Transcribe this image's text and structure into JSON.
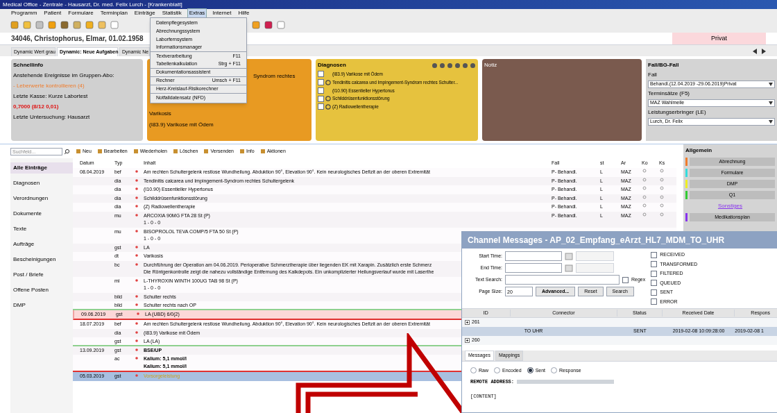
{
  "window": {
    "title": "Medical Office - Zentrale - Hausarzt, Dr. med. Felix Lurch - [Krankenblatt]"
  },
  "menu": [
    {
      "label": "Programm",
      "selected": false
    },
    {
      "label": "Patient",
      "selected": false
    },
    {
      "label": "Formulare",
      "selected": false
    },
    {
      "label": "Terminplan",
      "selected": false
    },
    {
      "label": "Einträge",
      "selected": false
    },
    {
      "label": "Statistik",
      "selected": false
    },
    {
      "label": "Extras",
      "selected": true
    },
    {
      "label": "Internet",
      "selected": false
    },
    {
      "label": "Hilfe",
      "selected": false
    }
  ],
  "dropdown": [
    {
      "label": "Datenpflegesystem",
      "separator_after": false
    },
    {
      "label": "Abrechnungssystem",
      "separator_after": false
    },
    {
      "label": "Laborfernsystem",
      "separator_after": false
    },
    {
      "label": "Informationsmanager",
      "separator_after": true
    },
    {
      "label": "Textverarbeitung",
      "shortcut": "F11",
      "separator_after": false
    },
    {
      "label": "Tabellenkalkulation",
      "shortcut": "Strg + F11",
      "separator_after": true
    },
    {
      "label": "Dokumentationsassistent",
      "separator_after": true
    },
    {
      "label": "Rechner",
      "shortcut": "Umsch + F11",
      "separator_after": true
    },
    {
      "label": "Herz-Kreislauf-Risikorechner",
      "separator_after": true
    },
    {
      "label": "Notfalldatensatz (NFD)",
      "separator_after": false
    }
  ],
  "patient": {
    "name": "34046, Christophorus, Elmar, 01.02.1958",
    "insurance": "Privat"
  },
  "tabs": [
    {
      "label": "Dynamic Wert grau",
      "selected": false
    },
    {
      "label": "Dynamic: Neue Aufgaben",
      "selected": true
    },
    {
      "label": "Dynamic Ne",
      "selected": false
    }
  ],
  "schnellinfo": {
    "title": "Schnellinfo",
    "lines": [
      {
        "kind": "normal",
        "text": "Anstehende Ereignisse im Gruppen-Abo:"
      },
      {
        "kind": "warning",
        "text": "- Leberwerte kontrollieren (4)"
      },
      {
        "kind": "normal",
        "text": "Letzte Kasse: Kurze Labortest"
      },
      {
        "kind": "alert",
        "text": "0,7000 (8/12 0,01)"
      },
      {
        "kind": "normal",
        "text": "Letzte Untersuchung: Hausarzt"
      }
    ]
  },
  "orange_panel": {
    "lines": [
      "Syndrom rechtes",
      "Varikosis",
      "(I83.9) Varikose mit Ödem"
    ]
  },
  "diagnosen": {
    "title": "Diagnosen",
    "items": [
      {
        "text": "(I83.9) Varikose mit Ödem",
        "checked": false,
        "permanent": false
      },
      {
        "text": "Tendinitis calcarea und Impingement-Syndrom rechtes Schulter...",
        "checked": false,
        "permanent": true
      },
      {
        "text": "(I10.90) Essentieller Hypertonus",
        "checked": false,
        "permanent": false
      },
      {
        "text": "Schilddrüsenfunktionsstörung",
        "checked": false,
        "permanent": true
      },
      {
        "text": "(Z) Radiowellentherapie",
        "checked": false,
        "permanent": true
      }
    ]
  },
  "notiz": {
    "title": "Notiz"
  },
  "fall_panel": {
    "title": "Fall/BG-Fall",
    "fields": [
      {
        "label": "Fall",
        "value": "Behandl.(12.04.2019 -29.06.2019)Privat"
      },
      {
        "label": "Terminsätze (F5)",
        "value": "MAZ Wahlmeile"
      },
      {
        "label": "Leistungserbringer (LE)",
        "value": "Lurch, Dr. Felix"
      }
    ]
  },
  "search": {
    "placeholder": "Suchfeld..."
  },
  "toolbar": [
    "Neu",
    "Bearbeiten",
    "Wiederholen",
    "Löschen",
    "Versenden",
    "Info",
    "Aktionen"
  ],
  "sidebar": [
    {
      "label": "Alle Einträge",
      "selected": true
    },
    {
      "label": "Diagnosen",
      "selected": false
    },
    {
      "label": "Verordnungen",
      "selected": false
    },
    {
      "label": "Dokumente",
      "selected": false
    },
    {
      "label": "Texte",
      "selected": false
    },
    {
      "label": "Aufträge",
      "selected": false
    },
    {
      "label": "Bescheinigungen",
      "selected": false
    },
    {
      "label": "Post / Briefe",
      "selected": false
    },
    {
      "label": "Offene Posten",
      "selected": false
    },
    {
      "label": "DMP",
      "selected": false
    }
  ],
  "table": {
    "columns": [
      "Datum",
      "Typ",
      "Inhalt",
      "Fall",
      "st",
      "Ar",
      "Ko",
      "Ks"
    ],
    "rows": [
      {
        "date": "08.04.2019",
        "type": "bef",
        "lines": [
          "Am rechten Schultergelenk restlose Wundheilung. Abduktion 90°, Elevation 90°. Kein neurologisches Defizit an der oberen Extremität"
        ],
        "fall": "P- Behandl.",
        "st": "L",
        "ar": "MAZ",
        "selected": false,
        "flagged": false,
        "bold": false,
        "day_end": false,
        "alert_line": false
      },
      {
        "type": "dia",
        "lines": [
          "Tendinitis calcarea und Impingement-Syndrom rechtes Schultergelenk"
        ],
        "fall": "P- Behandl.",
        "st": "L",
        "ar": "MAZ",
        "selected": false,
        "flagged": false,
        "bold": false,
        "day_end": false,
        "alert_line": false
      },
      {
        "type": "dia",
        "lines": [
          "(I10.90) Essentieller Hypertonus"
        ],
        "fall": "P- Behandl.",
        "st": "L",
        "ar": "MAZ",
        "selected": false,
        "flagged": false,
        "bold": false,
        "day_end": false,
        "alert_line": false
      },
      {
        "type": "dia",
        "lines": [
          "Schilddrüsenfunktionsstörung"
        ],
        "fall": "P- Behandl.",
        "st": "L",
        "ar": "MAZ",
        "selected": false,
        "flagged": false,
        "bold": false,
        "day_end": false,
        "alert_line": false
      },
      {
        "type": "dia",
        "lines": [
          "(Z) Radiowellentherapie"
        ],
        "fall": "P- Behandl.",
        "st": "L",
        "ar": "MAZ",
        "selected": false,
        "flagged": false,
        "bold": false,
        "day_end": false,
        "alert_line": false
      },
      {
        "type": "mu",
        "lines": [
          "ARCOXIA 90MG FTA 28 St (P)",
          "1 - 0 - 0"
        ],
        "fall": "P- Behandl.",
        "st": "L",
        "ar": "MAZ",
        "selected": false,
        "flagged": false,
        "bold": false,
        "day_end": false,
        "alert_line": false
      },
      {
        "type": "mu",
        "lines": [
          "BISOPROLOL TEVA COMP/5 FTA 50 St (P)",
          "1 - 0 - 0"
        ],
        "selected": false,
        "flagged": false,
        "bold": false,
        "day_end": false,
        "alert_line": false
      },
      {
        "type": "gst",
        "lines": [
          "LA"
        ],
        "selected": false,
        "flagged": false,
        "bold": false,
        "day_end": false,
        "alert_line": false
      },
      {
        "type": "dt",
        "lines": [
          "Varikosis"
        ],
        "selected": false,
        "flagged": false,
        "bold": false,
        "day_end": false,
        "alert_line": false
      },
      {
        "type": "bc",
        "lines": [
          "Durchführung der Operation am 04.06.2019. Perioperative Schmerztherapie über liegenden EK mit Xarapin. Zusätzlich erste Schmerz",
          "Die Röntgenkontrolle zeigt die nahezu vollständige Entfernung des Kalkdepots. Ein unkomplizierter Heilungsverlauf wurde mit Laserthe"
        ],
        "selected": false,
        "flagged": false,
        "bold": false,
        "day_end": false,
        "alert_line": false
      },
      {
        "type": "mi",
        "lines": [
          "L-THYROXIN WINTH 100UG TAB 98 St (P)",
          "1 - 0 - 0"
        ],
        "selected": false,
        "flagged": false,
        "bold": false,
        "day_end": false,
        "alert_line": false
      },
      {
        "type": "bild",
        "lines": [
          "Schulter rechts"
        ],
        "selected": false,
        "flagged": false,
        "bold": false,
        "day_end": false,
        "alert_line": false
      },
      {
        "type": "bild",
        "lines": [
          "Schulter rechts nach OP"
        ],
        "selected": false,
        "flagged": false,
        "bold": false,
        "day_end": true,
        "alert_line": false
      },
      {
        "date": "09.06.2019",
        "type": "gst",
        "lines": [
          "LA (UBD) 6/0(2)"
        ],
        "selected": false,
        "flagged": true,
        "bold": false,
        "day_end": false,
        "alert_line": true
      },
      {
        "date": "18.07.2019",
        "type": "bef",
        "lines": [
          "Am rechten Schultergelenk restlose Wundheilung. Abduktion 90°, Elevation 90°. Kein neurologisches Defizit an der oberen Extremität"
        ],
        "selected": false,
        "flagged": false,
        "bold": false,
        "day_end": false,
        "alert_line": false
      },
      {
        "type": "dia",
        "lines": [
          "(I83.9) Varikose mit Ödem"
        ],
        "selected": false,
        "flagged": false,
        "bold": false,
        "day_end": false,
        "alert_line": false
      },
      {
        "type": "gst",
        "lines": [
          "LA (LA)"
        ],
        "selected": false,
        "flagged": false,
        "bold": false,
        "day_end": true,
        "alert_line": false
      },
      {
        "date": "13.09.2019",
        "type": "gst",
        "lines": [
          "BSE/UP"
        ],
        "selected": false,
        "flagged": false,
        "bold": true,
        "day_end": false,
        "alert_line": false
      },
      {
        "type": "ac",
        "lines": [
          "Kalium: 5,1 mmol/l",
          "Kalium: 5,1 mmol/l"
        ],
        "selected": false,
        "flagged": false,
        "bold": true,
        "day_end": false,
        "alert_line": true
      },
      {
        "date": "05.03.2019",
        "type": "gst",
        "lines": [
          "Vorsorgeleistung"
        ],
        "selected": true,
        "flagged": false,
        "bold": false,
        "day_end": false,
        "alert_line": false
      }
    ]
  },
  "allgemein": {
    "title": "Allgemein",
    "items": [
      {
        "kind": "button",
        "label": "Abrechnung",
        "color": "#f07c2c"
      },
      {
        "kind": "button",
        "label": "Formulare",
        "color": "#33dddd"
      },
      {
        "kind": "button",
        "label": "DMP",
        "color": "#eeee22"
      },
      {
        "kind": "button",
        "label": "Q1",
        "color": "#33cc33"
      },
      {
        "kind": "link",
        "label": "Sonstiges",
        "color": "#8833ee"
      },
      {
        "kind": "button",
        "label": "Medikationsplan",
        "color": "#8833ee"
      }
    ]
  },
  "dialog": {
    "title": "Channel Messages - AP_02_Empfang_eArzt_HL7_MDM_TO_UHR",
    "fields": [
      {
        "kind": "datetime",
        "label": "Start Time:"
      },
      {
        "kind": "datetime",
        "label": "End Time:"
      },
      {
        "kind": "search",
        "label": "Text Search:"
      },
      {
        "kind": "size",
        "label": "Page Size:",
        "value": "20"
      }
    ],
    "regex": {
      "label": "Regex",
      "checked": false
    },
    "statuses": [
      {
        "label": "RECEIVED",
        "checked": false
      },
      {
        "label": "TRANSFORMED",
        "checked": false
      },
      {
        "label": "FILTERED",
        "checked": false
      },
      {
        "label": "QUEUED",
        "checked": false
      },
      {
        "label": "SENT",
        "checked": false
      },
      {
        "label": "ERROR",
        "checked": false
      }
    ],
    "buttons": [
      "Advanced...",
      "Reset",
      "Search"
    ],
    "columns": [
      "ID",
      "Connector",
      "Status",
      "Received Date",
      "Respons"
    ],
    "rows": [
      {
        "kind": "group",
        "id": "261",
        "selected": false
      },
      {
        "kind": "child",
        "connector": "TO UHR",
        "status": "SENT",
        "received": "2019-02-08 10:09:28:00",
        "response": "2019-02-08 1",
        "selected": true
      },
      {
        "kind": "group",
        "id": "260",
        "selected": false
      }
    ],
    "tabs": [
      {
        "label": "Messages",
        "selected": true
      },
      {
        "label": "Mappings",
        "selected": false
      }
    ],
    "radios": [
      {
        "label": "Raw",
        "selected": false
      },
      {
        "label": "Encoded",
        "selected": false
      },
      {
        "label": "Sent",
        "selected": true
      },
      {
        "label": "Response",
        "selected": false
      }
    ],
    "remote_label": "REMOTE ADDRESS:",
    "content_label": "[CONTENT]"
  }
}
